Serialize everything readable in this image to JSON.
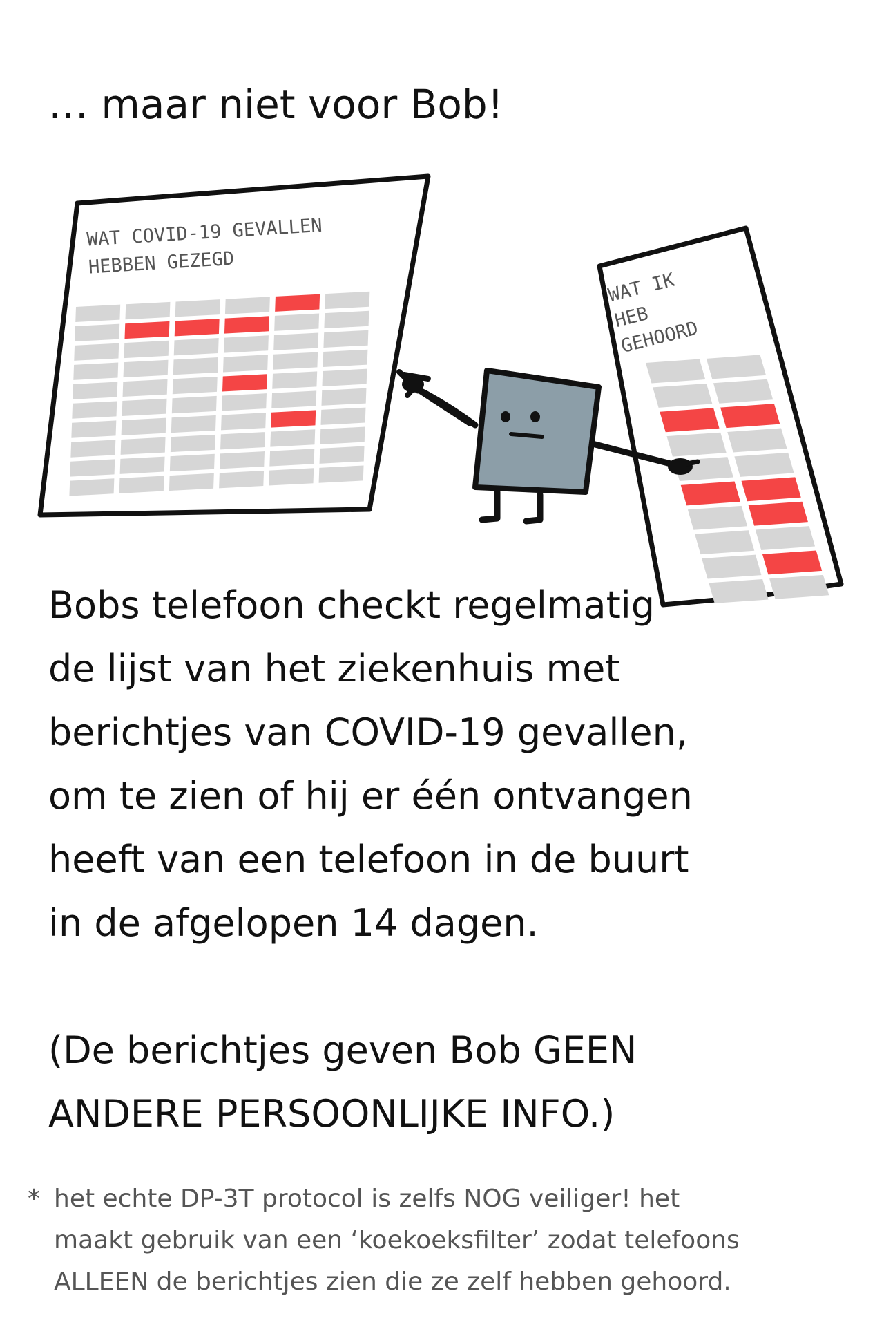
{
  "intro": "… maar niet voor Bob!",
  "big_list": {
    "title_line1": "WAT COVID-19 GEVALLEN",
    "title_line2": "HEBBEN GEZEGD"
  },
  "small_list": {
    "title_line1": "WAT IK",
    "title_line2": "HEB",
    "title_line3": "GEHOORD"
  },
  "body_lines": [
    "Bobs telefoon checkt regelmatig",
    "de lijst van het ziekenhuis met",
    "berichtjes van COVID-19 gevallen,",
    "om te zien of hij er één ontvangen",
    "heeft van een telefoon in de buurt",
    "in de afgelopen 14 dagen."
  ],
  "note_lines": [
    "(De berichtjes geven Bob GEEN",
    "ANDERE PERSOONLIJKE INFO.)"
  ],
  "footnote": {
    "star": "*",
    "lines": [
      "het echte DP-3T protocol is zelfs NOG veiliger! het",
      "maakt gebruik van een ‘koekoeksfilter’ zodat telefoons",
      "ALLEEN de berichtjes zien die ze zelf hebben gehoord."
    ]
  },
  "colors": {
    "cell_grey": "#d6d6d6",
    "cell_red": "#f44545",
    "phone_body": "#8c9ea8",
    "outline": "#111111"
  }
}
